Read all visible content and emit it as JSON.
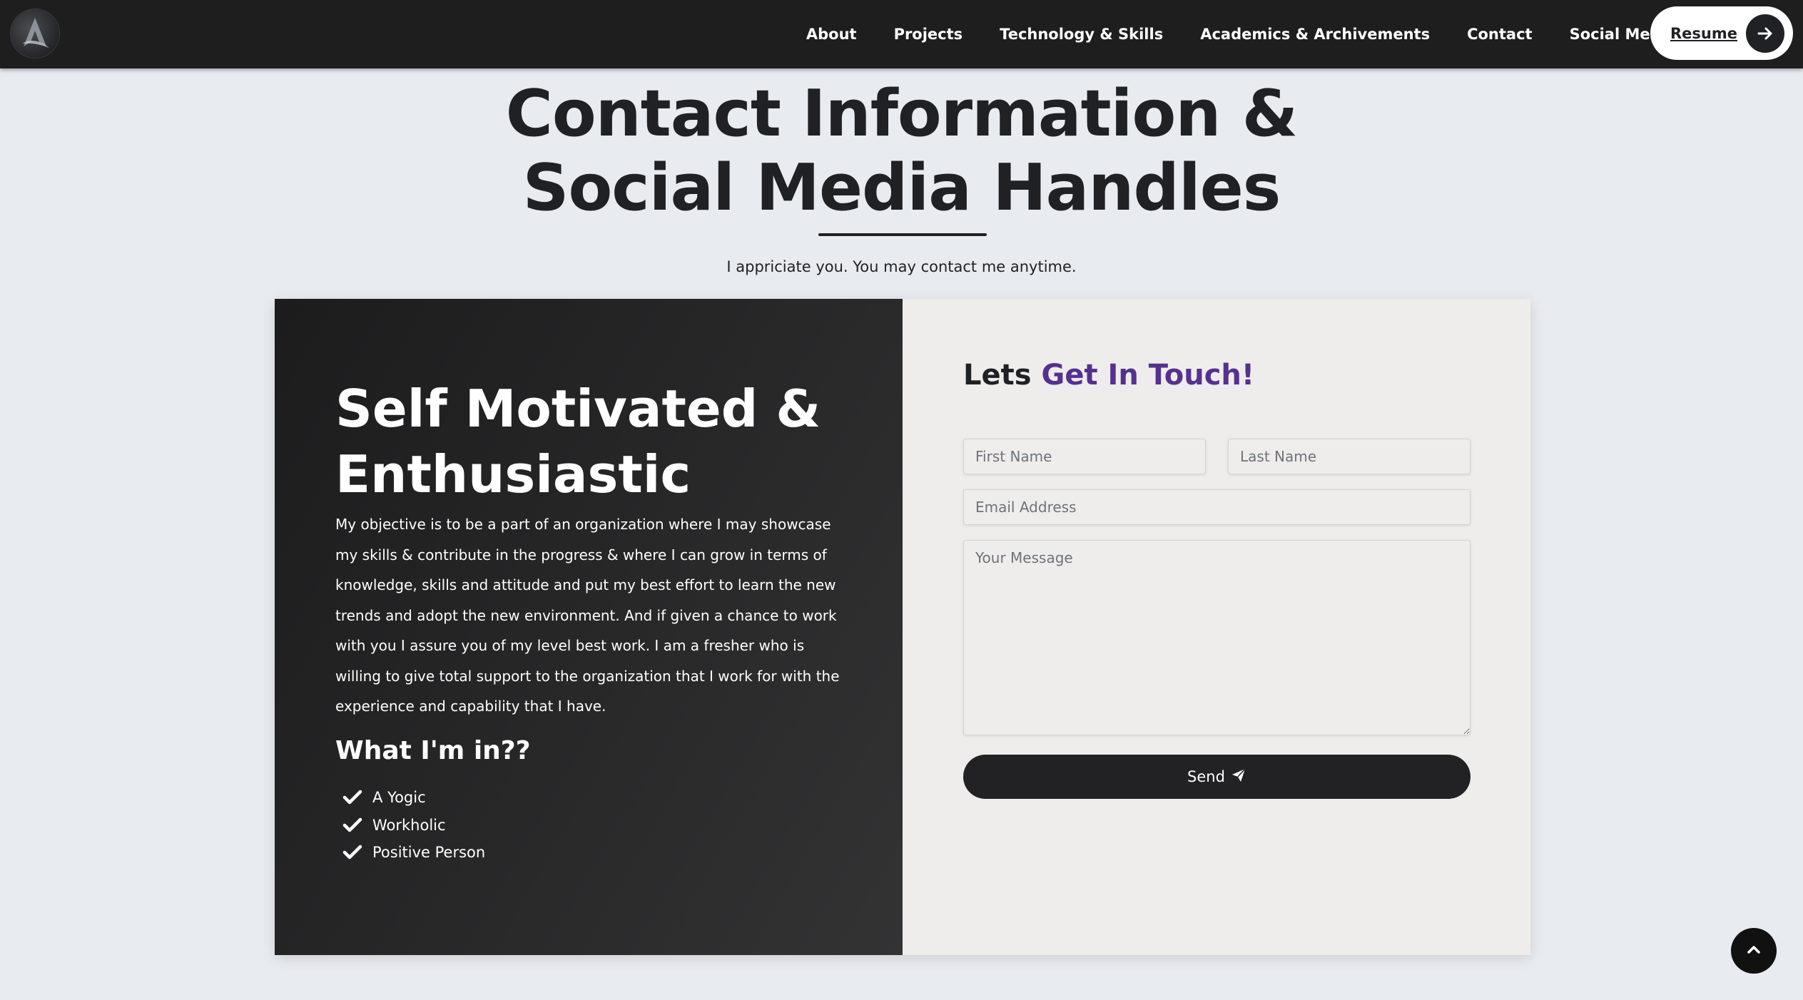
{
  "nav": {
    "logo_name": "site-logo",
    "links": [
      "About",
      "Projects",
      "Technology & Skills",
      "Academics & Archivements",
      "Contact",
      "Social Media"
    ],
    "resume_label": "Resume"
  },
  "header": {
    "title_line1": "Contact Information &",
    "title_line2": "Social Media Handles",
    "subtitle": "I appriciate you. You may contact me anytime."
  },
  "left_panel": {
    "heading_line1": "Self Motivated &",
    "heading_line2": "Enthusiastic",
    "body": "My objective is to be a part of an organization where I may showcase my skills & contribute in the progress & where I can grow in terms of knowledge, skills and attitude and put my best effort to learn the new trends and adopt the new environment. And if given a chance to work with you I assure you of my level best work. I am a fresher who is willing to give total support to the organization that I work for with the experience and capability that I have.",
    "subheading": "What I'm in??",
    "interests": [
      "A Yogic",
      "Workholic",
      "Positive Person"
    ]
  },
  "form": {
    "title_plain": "Lets",
    "title_accent": "Get In Touch!",
    "first_name_placeholder": "First Name",
    "last_name_placeholder": "Last Name",
    "email_placeholder": "Email Address",
    "message_placeholder": "Your Message",
    "send_label": "Send"
  },
  "colors": {
    "nav_bg": "#1e1e1f",
    "page_bg": "#e8ebef",
    "accent": "#54318f",
    "dark": "#1f2124",
    "form_bg": "#efecec"
  },
  "icons": {
    "resume_arrow": "arrow-right-icon",
    "send": "paper-plane-icon",
    "interest_bullet": "check-icon",
    "scroll_top": "chevron-up-icon"
  }
}
